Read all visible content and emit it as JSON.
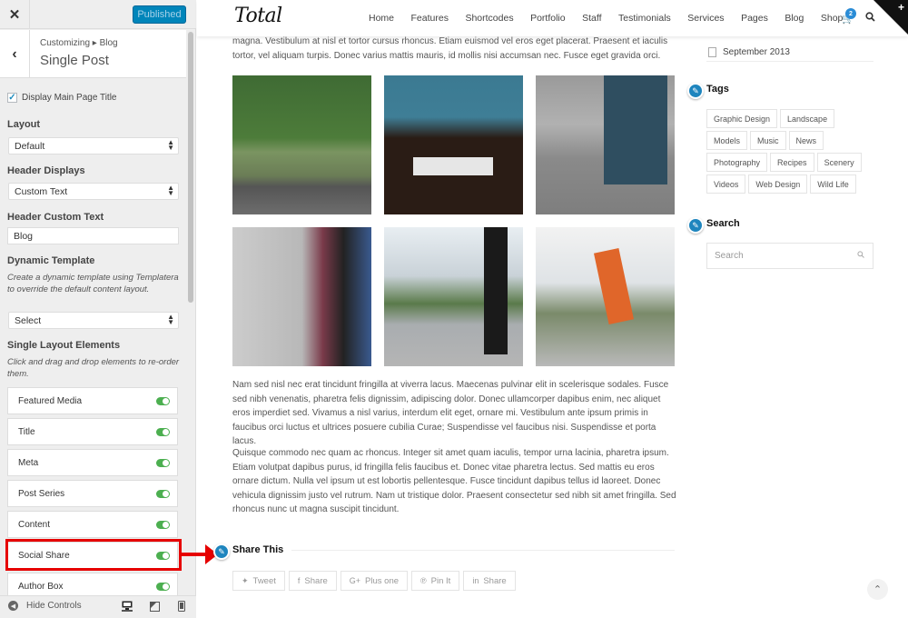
{
  "customizer": {
    "close_icon": "close-icon",
    "publish_label": "Published",
    "breadcrumb": "Customizing ▸ Blog",
    "section_title": "Single Post",
    "display_main_title": {
      "label": "Display Main Page Title",
      "checked": true
    },
    "layout": {
      "label": "Layout",
      "value": "Default"
    },
    "header_displays": {
      "label": "Header Displays",
      "value": "Custom Text"
    },
    "header_custom_text": {
      "label": "Header Custom Text",
      "value": "Blog"
    },
    "dynamic_template": {
      "label": "Dynamic Template",
      "description": "Create a dynamic template using Templatera to override the default content layout.",
      "value": "Select"
    },
    "single_layout": {
      "label": "Single Layout Elements",
      "description": "Click and drag and drop elements to re-order them.",
      "items": [
        {
          "label": "Featured Media",
          "enabled": true
        },
        {
          "label": "Title",
          "enabled": true
        },
        {
          "label": "Meta",
          "enabled": true
        },
        {
          "label": "Post Series",
          "enabled": true
        },
        {
          "label": "Content",
          "enabled": true
        },
        {
          "label": "Social Share",
          "enabled": true,
          "highlighted": true
        },
        {
          "label": "Author Box",
          "enabled": true
        }
      ]
    },
    "footer": {
      "hide_controls": "Hide Controls",
      "devices": [
        "desktop",
        "tablet",
        "mobile"
      ],
      "active_device": "desktop"
    }
  },
  "site": {
    "logo": "Total",
    "nav": [
      "Home",
      "Features",
      "Shortcodes",
      "Portfolio",
      "Staff",
      "Testimonials",
      "Services",
      "Pages",
      "Blog",
      "Shop"
    ],
    "cart_count": "2"
  },
  "post": {
    "intro": "magna. Vestibulum at nisl et tortor cursus rhoncus. Etiam euismod vel eros eget placerat. Praesent et iaculis tortor, vel aliquam turpis. Donec varius mattis mauris, id mollis nisi accumsan nec. Fusce eget gravida orci.",
    "gallery": [
      "Green vintage truck",
      "Person at desk with keyboard",
      "Legs in jeans on street",
      "Person holding camera in chair",
      "Runner in city park",
      "Stretching with orange shoe"
    ],
    "paragraph1": "Nam sed nisl nec erat tincidunt fringilla at viverra lacus. Maecenas pulvinar elit in scelerisque sodales. Fusce sed nibh venenatis, pharetra felis dignissim, adipiscing dolor. Donec ullamcorper dapibus enim, nec aliquet eros imperdiet sed. Vivamus a nisl varius, interdum elit eget, ornare mi. Vestibulum ante ipsum primis in faucibus orci luctus et ultrices posuere cubilia Curae; Suspendisse vel faucibus nisi. Suspendisse et porta lacus.",
    "paragraph2": "Quisque commodo nec quam ac rhoncus. Integer sit amet quam iaculis, tempor urna lacinia, pharetra ipsum. Etiam volutpat dapibus purus, id fringilla felis faucibus et. Donec vitae pharetra lectus. Sed mattis eu eros ornare dictum. Nulla vel ipsum ut est lobortis pellentesque. Fusce tincidunt dapibus tellus id laoreet. Donec vehicula dignissim justo vel rutrum. Nam ut tristique dolor. Praesent consectetur sed nibh sit amet fringilla. Sed rhoncus nunc ut magna suscipit tincidunt.",
    "share": {
      "title": "Share This",
      "buttons": [
        {
          "icon": "twitter-icon",
          "glyph": "🐦",
          "label": "Tweet"
        },
        {
          "icon": "facebook-icon",
          "glyph": "f",
          "label": "Share"
        },
        {
          "icon": "google-plus-icon",
          "glyph": "G+",
          "label": "Plus one"
        },
        {
          "icon": "pinterest-icon",
          "glyph": "℗",
          "label": "Pin It"
        },
        {
          "icon": "linkedin-icon",
          "glyph": "in",
          "label": "Share"
        }
      ]
    }
  },
  "widgets": {
    "archive_item": "September 2013",
    "tags_title": "Tags",
    "tags": [
      "Graphic Design",
      "Landscape",
      "Models",
      "Music",
      "News",
      "Photography",
      "Recipes",
      "Scenery",
      "Videos",
      "Web Design",
      "Wild Life"
    ],
    "search_title": "Search",
    "search_placeholder": "Search"
  }
}
